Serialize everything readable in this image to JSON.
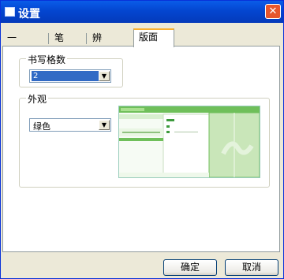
{
  "window": {
    "title": "设置",
    "close_label": "✕"
  },
  "tabs": [
    {
      "label": "一般"
    },
    {
      "label": "笔迹"
    },
    {
      "label": "辨识核心"
    },
    {
      "label": "版面",
      "active": true
    }
  ],
  "panel": {
    "grid_group": {
      "label": "书写格数",
      "value": "2"
    },
    "appearance_group": {
      "label": "外观",
      "value": "绿色"
    }
  },
  "buttons": {
    "ok": "确定",
    "cancel": "取消"
  },
  "colors": {
    "accent": "#316ac5",
    "theme_green": "#6fbf5a",
    "titlebar": "#0a5ce8"
  }
}
